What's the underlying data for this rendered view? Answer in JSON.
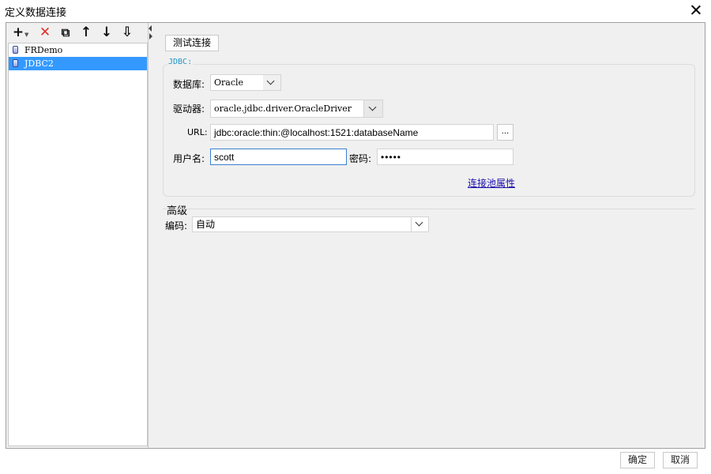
{
  "window": {
    "title": "定义数据连接"
  },
  "toolbar": {
    "add": "+",
    "delete": "✕",
    "copy": "⧉",
    "move_up": "↑",
    "move_down": "↓",
    "sort": "⇩"
  },
  "tree": {
    "items": [
      {
        "label": "FRDemo",
        "selected": false
      },
      {
        "label": "JDBC2",
        "selected": true
      }
    ]
  },
  "form": {
    "test_connection_label": "测试连接",
    "group_label": "JDBC:",
    "database_label": "数据库:",
    "database_value": "Oracle",
    "driver_label": "驱动器:",
    "driver_value": "oracle.jdbc.driver.OracleDriver",
    "url_label": "URL:",
    "url_value": "jdbc:oracle:thin:@localhost:1521:databaseName",
    "url_browse": "...",
    "username_label": "用户名:",
    "username_value": "scott",
    "password_label": "密码:",
    "password_value": "•••••",
    "pool_link": "连接池属性",
    "advanced_label": "高级",
    "encoding_label": "编码:",
    "encoding_value": "自动"
  },
  "footer": {
    "ok_label": "确定",
    "cancel_label": "取消"
  }
}
